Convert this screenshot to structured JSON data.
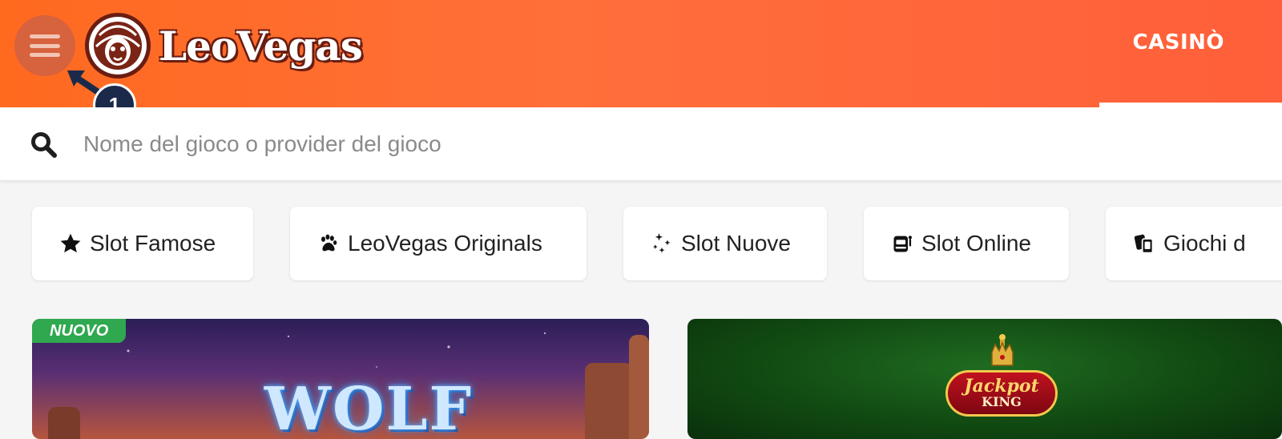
{
  "header": {
    "brand": "LeoVegas",
    "nav_active": "CASINÒ",
    "menu_icon": "hamburger-icon"
  },
  "annotation": {
    "step_number": "1"
  },
  "search": {
    "placeholder": "Nome del gioco o provider del gioco",
    "value": "",
    "icon": "search-icon"
  },
  "categories": [
    {
      "label": "Slot Famose",
      "icon": "star-icon"
    },
    {
      "label": "LeoVegas Originals",
      "icon": "paw-icon"
    },
    {
      "label": "Slot Nuove",
      "icon": "sparkles-icon"
    },
    {
      "label": "Slot Online",
      "icon": "slot-machine-icon"
    },
    {
      "label": "Giochi d",
      "icon": "cards-icon"
    }
  ],
  "games": [
    {
      "badge": "NUOVO",
      "title": "WOLF"
    },
    {
      "title_line1": "Jackpot",
      "title_line2": "KING"
    }
  ],
  "colors": {
    "header_orange": "#ff6a1f",
    "annotation_navy": "#1b2a4a",
    "new_badge_green": "#2fa84f"
  }
}
